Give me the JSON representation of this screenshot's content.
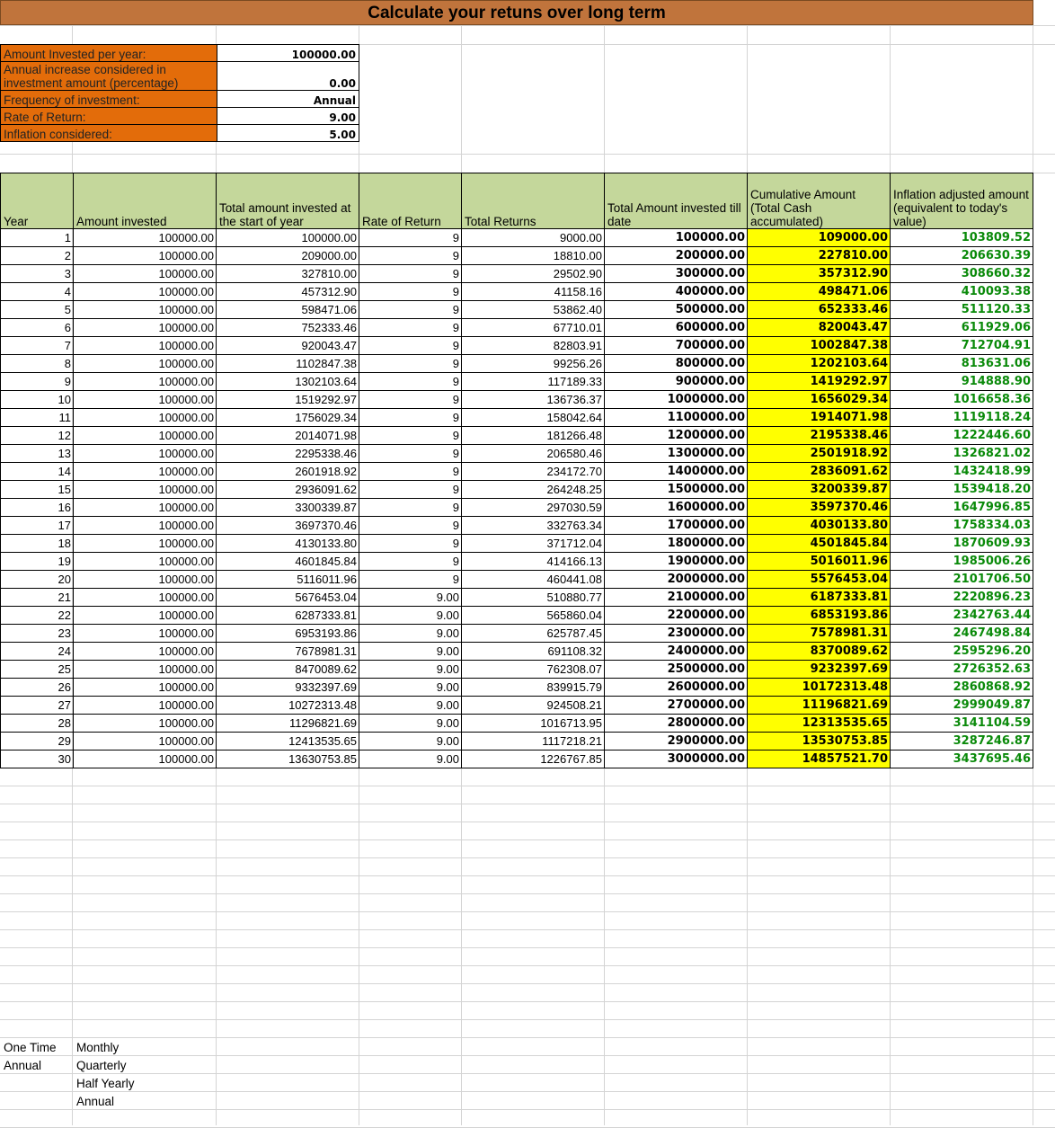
{
  "title": "Calculate your retuns over long term",
  "params": [
    {
      "label": "Amount Invested per year:",
      "value": "100000.00"
    },
    {
      "label": "Annual increase considered in investment amount (percentage)",
      "value": "0.00"
    },
    {
      "label": "Frequency of investment:",
      "value": "Annual"
    },
    {
      "label": "Rate of Return:",
      "value": "9.00"
    },
    {
      "label": "Inflation considered:",
      "value": "5.00"
    }
  ],
  "table": {
    "headers": [
      "Year",
      "Amount invested",
      "Total amount invested at the start of year",
      "Rate of Return",
      "Total Returns",
      "Total Amount invested till date",
      "Cumulative Amount (Total Cash accumulated)",
      "Inflation adjusted amount (equivalent to today's value)"
    ],
    "rows": [
      [
        "1",
        "100000.00",
        "100000.00",
        "9",
        "9000.00",
        "100000.00",
        "109000.00",
        "103809.52"
      ],
      [
        "2",
        "100000.00",
        "209000.00",
        "9",
        "18810.00",
        "200000.00",
        "227810.00",
        "206630.39"
      ],
      [
        "3",
        "100000.00",
        "327810.00",
        "9",
        "29502.90",
        "300000.00",
        "357312.90",
        "308660.32"
      ],
      [
        "4",
        "100000.00",
        "457312.90",
        "9",
        "41158.16",
        "400000.00",
        "498471.06",
        "410093.38"
      ],
      [
        "5",
        "100000.00",
        "598471.06",
        "9",
        "53862.40",
        "500000.00",
        "652333.46",
        "511120.33"
      ],
      [
        "6",
        "100000.00",
        "752333.46",
        "9",
        "67710.01",
        "600000.00",
        "820043.47",
        "611929.06"
      ],
      [
        "7",
        "100000.00",
        "920043.47",
        "9",
        "82803.91",
        "700000.00",
        "1002847.38",
        "712704.91"
      ],
      [
        "8",
        "100000.00",
        "1102847.38",
        "9",
        "99256.26",
        "800000.00",
        "1202103.64",
        "813631.06"
      ],
      [
        "9",
        "100000.00",
        "1302103.64",
        "9",
        "117189.33",
        "900000.00",
        "1419292.97",
        "914888.90"
      ],
      [
        "10",
        "100000.00",
        "1519292.97",
        "9",
        "136736.37",
        "1000000.00",
        "1656029.34",
        "1016658.36"
      ],
      [
        "11",
        "100000.00",
        "1756029.34",
        "9",
        "158042.64",
        "1100000.00",
        "1914071.98",
        "1119118.24"
      ],
      [
        "12",
        "100000.00",
        "2014071.98",
        "9",
        "181266.48",
        "1200000.00",
        "2195338.46",
        "1222446.60"
      ],
      [
        "13",
        "100000.00",
        "2295338.46",
        "9",
        "206580.46",
        "1300000.00",
        "2501918.92",
        "1326821.02"
      ],
      [
        "14",
        "100000.00",
        "2601918.92",
        "9",
        "234172.70",
        "1400000.00",
        "2836091.62",
        "1432418.99"
      ],
      [
        "15",
        "100000.00",
        "2936091.62",
        "9",
        "264248.25",
        "1500000.00",
        "3200339.87",
        "1539418.20"
      ],
      [
        "16",
        "100000.00",
        "3300339.87",
        "9",
        "297030.59",
        "1600000.00",
        "3597370.46",
        "1647996.85"
      ],
      [
        "17",
        "100000.00",
        "3697370.46",
        "9",
        "332763.34",
        "1700000.00",
        "4030133.80",
        "1758334.03"
      ],
      [
        "18",
        "100000.00",
        "4130133.80",
        "9",
        "371712.04",
        "1800000.00",
        "4501845.84",
        "1870609.93"
      ],
      [
        "19",
        "100000.00",
        "4601845.84",
        "9",
        "414166.13",
        "1900000.00",
        "5016011.96",
        "1985006.26"
      ],
      [
        "20",
        "100000.00",
        "5116011.96",
        "9",
        "460441.08",
        "2000000.00",
        "5576453.04",
        "2101706.50"
      ],
      [
        "21",
        "100000.00",
        "5676453.04",
        "9.00",
        "510880.77",
        "2100000.00",
        "6187333.81",
        "2220896.23"
      ],
      [
        "22",
        "100000.00",
        "6287333.81",
        "9.00",
        "565860.04",
        "2200000.00",
        "6853193.86",
        "2342763.44"
      ],
      [
        "23",
        "100000.00",
        "6953193.86",
        "9.00",
        "625787.45",
        "2300000.00",
        "7578981.31",
        "2467498.84"
      ],
      [
        "24",
        "100000.00",
        "7678981.31",
        "9.00",
        "691108.32",
        "2400000.00",
        "8370089.62",
        "2595296.20"
      ],
      [
        "25",
        "100000.00",
        "8470089.62",
        "9.00",
        "762308.07",
        "2500000.00",
        "9232397.69",
        "2726352.63"
      ],
      [
        "26",
        "100000.00",
        "9332397.69",
        "9.00",
        "839915.79",
        "2600000.00",
        "10172313.48",
        "2860868.92"
      ],
      [
        "27",
        "100000.00",
        "10272313.48",
        "9.00",
        "924508.21",
        "2700000.00",
        "11196821.69",
        "2999049.87"
      ],
      [
        "28",
        "100000.00",
        "11296821.69",
        "9.00",
        "1016713.95",
        "2800000.00",
        "12313535.65",
        "3141104.59"
      ],
      [
        "29",
        "100000.00",
        "12413535.65",
        "9.00",
        "1117218.21",
        "2900000.00",
        "13530753.85",
        "3287246.87"
      ],
      [
        "30",
        "100000.00",
        "13630753.85",
        "9.00",
        "1226767.85",
        "3000000.00",
        "14857521.70",
        "3437695.46"
      ]
    ]
  },
  "lists": {
    "col1": [
      "One Time",
      "Annual"
    ],
    "col2": [
      "Monthly",
      "Quarterly",
      "Half Yearly",
      "Annual"
    ]
  }
}
